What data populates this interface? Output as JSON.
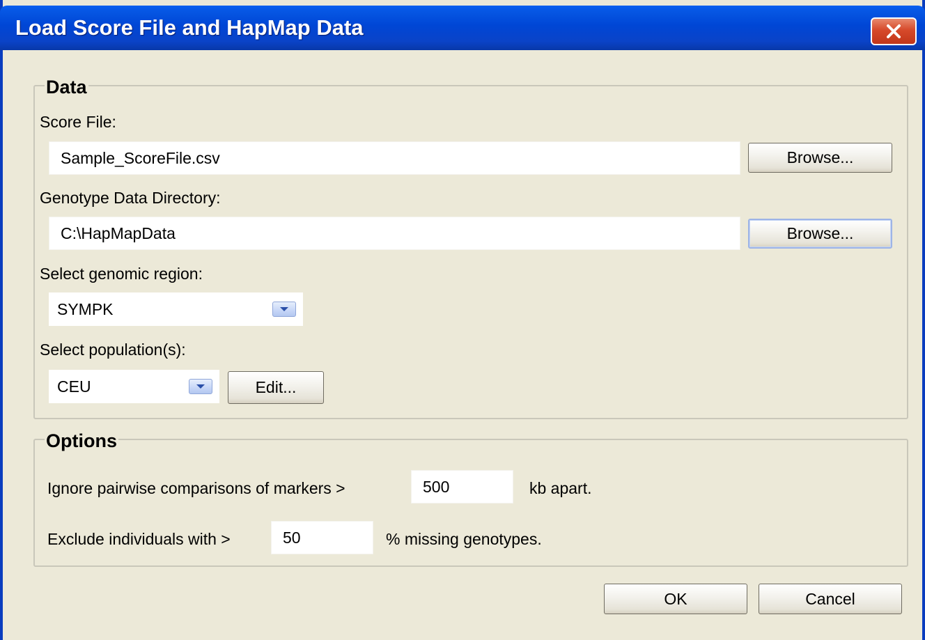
{
  "window": {
    "title": "Load Score File and HapMap Data",
    "close_glyph": "✕"
  },
  "data_group": {
    "legend": "Data",
    "score_file": {
      "label": "Score File:",
      "value": "Sample_ScoreFile.csv",
      "browse_label": "Browse..."
    },
    "genotype_dir": {
      "label": "Genotype Data Directory:",
      "value": "C:\\HapMapData",
      "browse_label": "Browse..."
    },
    "genomic_region": {
      "label": "Select genomic region:",
      "selected": "SYMPK"
    },
    "population": {
      "label": "Select population(s):",
      "selected": "CEU",
      "edit_label": "Edit..."
    }
  },
  "options_group": {
    "legend": "Options",
    "pairwise": {
      "prefix": "Ignore pairwise comparisons of markers >",
      "value": "500",
      "suffix": "kb apart."
    },
    "missing": {
      "prefix": "Exclude individuals with >",
      "value": "50",
      "suffix": "% missing genotypes."
    }
  },
  "footer": {
    "ok_label": "OK",
    "cancel_label": "Cancel"
  },
  "colors": {
    "titlebar": "#0046D5",
    "dialog_bg": "#ECE9D8",
    "close_button": "#D6492A",
    "combo_arrow": "#C6D6F7"
  },
  "icons": {
    "close": "close-icon",
    "dropdown": "chevron-down-icon"
  }
}
